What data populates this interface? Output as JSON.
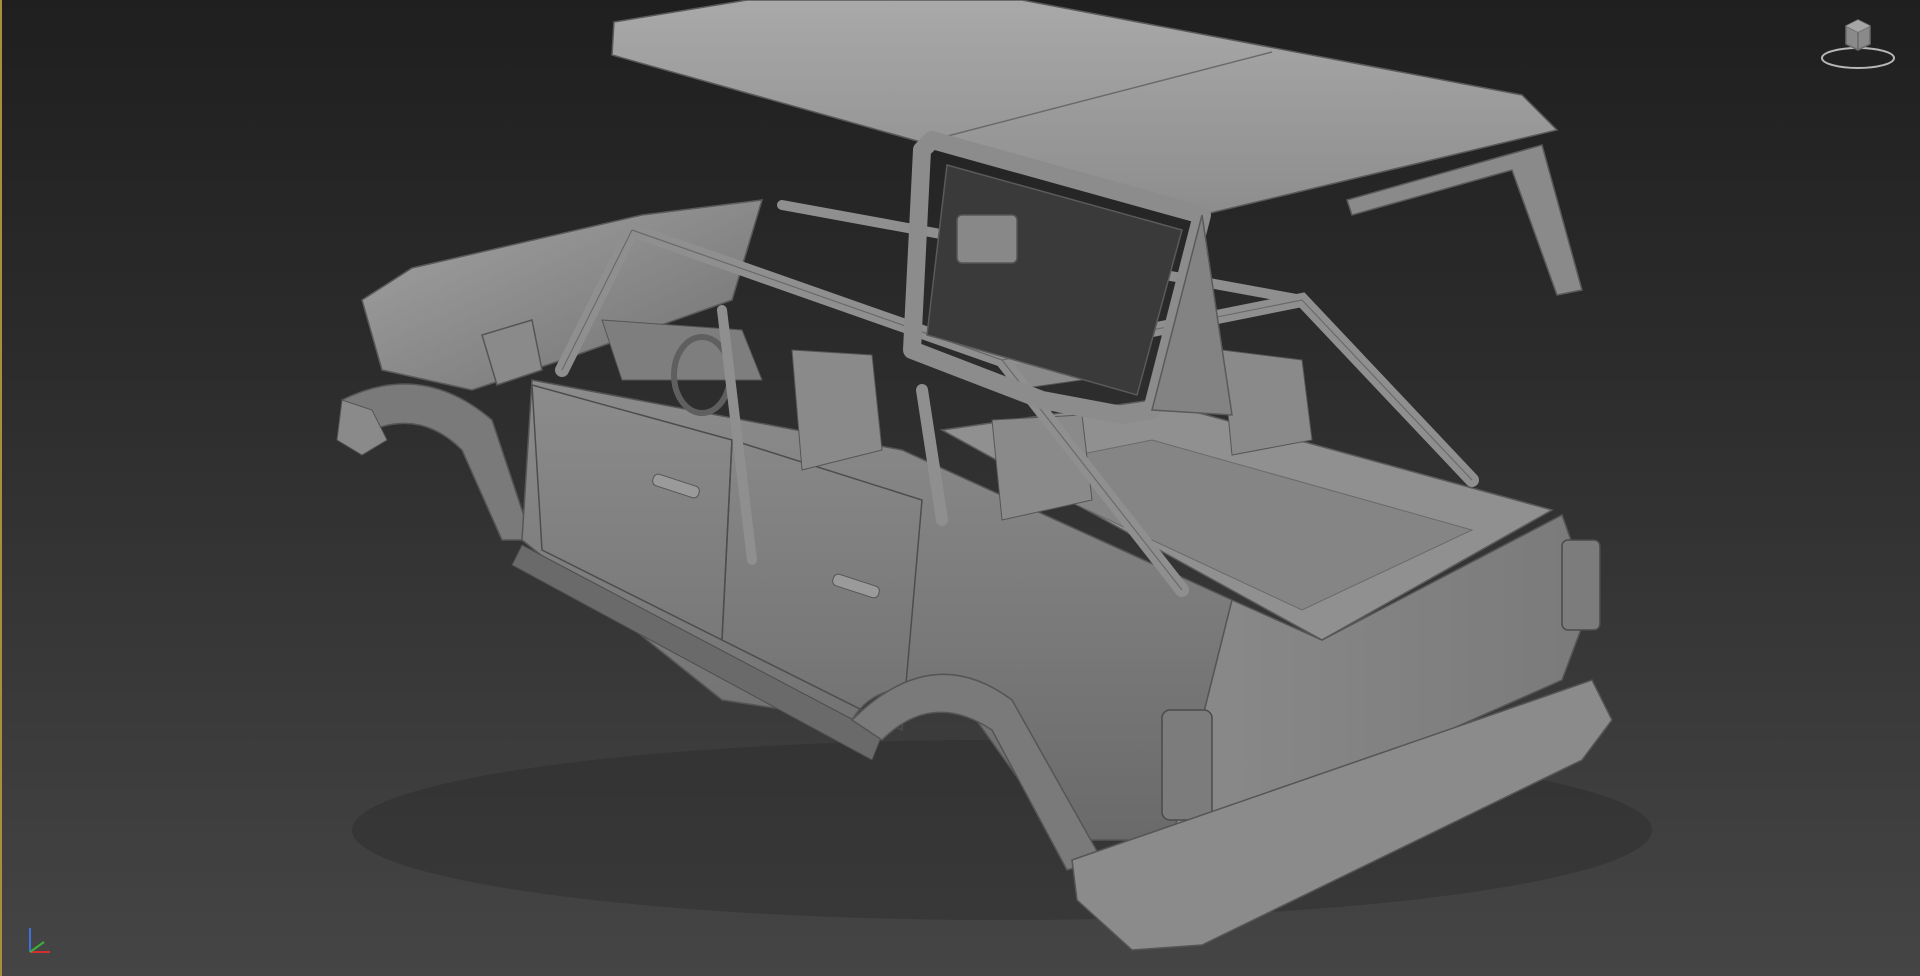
{
  "app": {
    "name": "3D viewport",
    "view": "perspective"
  },
  "viewport": {
    "shading": "clay",
    "border_color": "#a88f3a",
    "background_top": "#1f1f1f",
    "background_bottom": "#454545"
  },
  "model": {
    "base_color": "#8e8e8e",
    "parts": [
      "hard-top-roof",
      "body-shell",
      "roll-cage",
      "front-seats",
      "rear-seats",
      "dashboard",
      "steering-wheel",
      "front-door",
      "rear-door",
      "wheel-arches",
      "tail-lights",
      "rear-bumper",
      "side-step"
    ]
  },
  "viewcube": {
    "icon": "viewcube-icon"
  },
  "axis_tripod": {
    "icon": "axis-tripod-icon",
    "x_color": "#d23030",
    "y_color": "#3cb03c",
    "z_color": "#3f6fd8"
  }
}
